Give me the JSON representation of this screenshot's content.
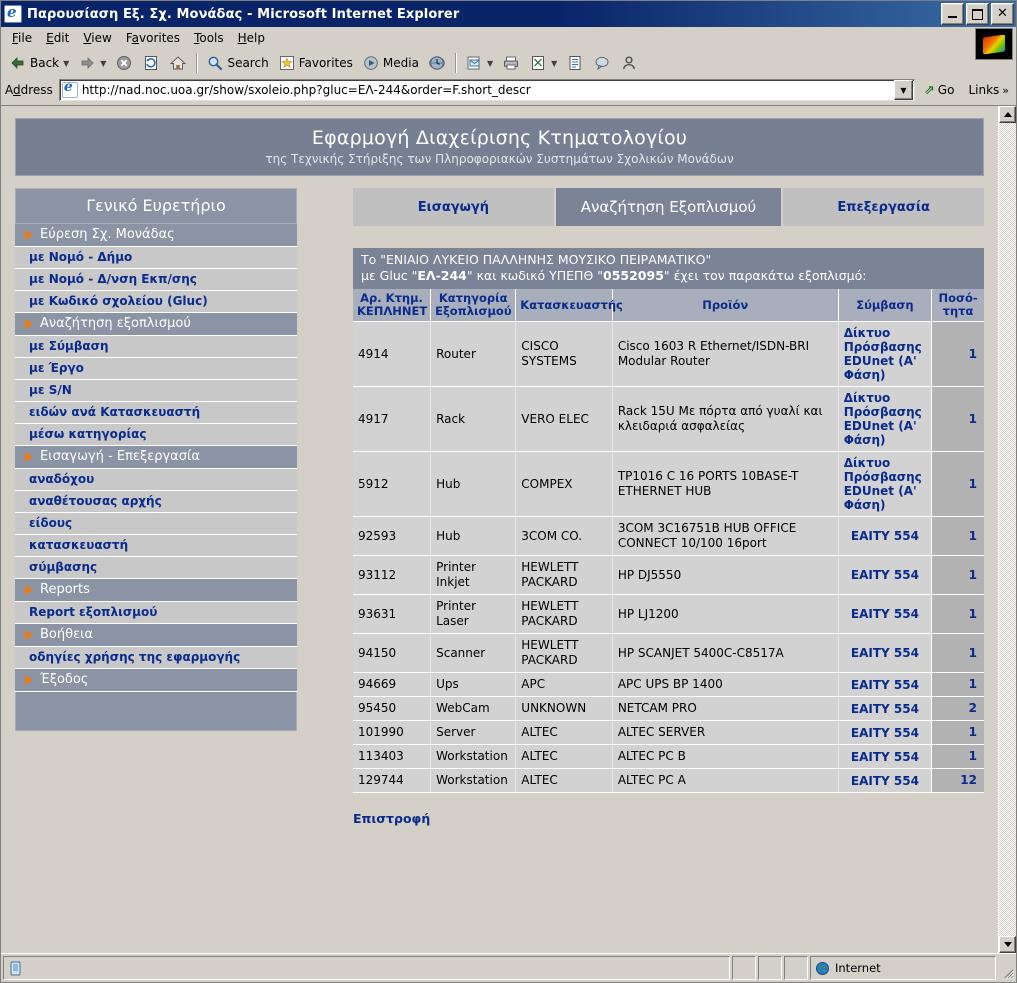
{
  "window": {
    "title": "Παρουσίαση Εξ. Σχ. Μονάδας - Microsoft Internet Explorer",
    "minimize_label": "_",
    "maximize_label": "□",
    "close_label": "✕"
  },
  "menu": {
    "items": [
      {
        "label": "File"
      },
      {
        "label": "Edit"
      },
      {
        "label": "View"
      },
      {
        "label": "Favorites"
      },
      {
        "label": "Tools"
      },
      {
        "label": "Help"
      }
    ]
  },
  "toolbar": {
    "back_label": "Back",
    "search_label": "Search",
    "favorites_label": "Favorites",
    "media_label": "Media"
  },
  "address": {
    "label": "Address",
    "url": "http://nad.noc.uoa.gr/show/sxoleio.php?gluc=ΕΛ-244&order=F.short_descr",
    "go_label": "Go",
    "links_label": "Links"
  },
  "app_header": {
    "title": "Εφαρμογή Διαχείρισης Κτηματολογίου",
    "subtitle": "της Τεχνικής Στήριξης των Πληροφοριακών Συστημάτων Σχολικών Μονάδων"
  },
  "sidebar": {
    "title": "Γενικό Ευρετήριο",
    "items": [
      {
        "label": "Εύρεση Σχ. Μονάδας",
        "type": "group"
      },
      {
        "label": "με Νομό - Δήμο",
        "type": "link"
      },
      {
        "label": "με Νομό - Δ/νση Εκπ/σης",
        "type": "link"
      },
      {
        "label": "με Κωδικό σχολείου (Gluc)",
        "type": "link"
      },
      {
        "label": "Αναζήτηση εξοπλισμού",
        "type": "group"
      },
      {
        "label": "με Σύμβαση",
        "type": "link"
      },
      {
        "label": "με Έργο",
        "type": "link"
      },
      {
        "label": "με S/N",
        "type": "link"
      },
      {
        "label": "ειδών ανά Κατασκευαστή",
        "type": "link"
      },
      {
        "label": "μέσω κατηγορίας",
        "type": "link"
      },
      {
        "label": "Εισαγωγή - Επεξεργασία",
        "type": "group"
      },
      {
        "label": "αναδόχου",
        "type": "link"
      },
      {
        "label": "αναθέτουσας αρχής",
        "type": "link"
      },
      {
        "label": "είδους",
        "type": "link"
      },
      {
        "label": "κατασκευαστή",
        "type": "link"
      },
      {
        "label": "σύμβασης",
        "type": "link"
      },
      {
        "label": "Reports",
        "type": "group"
      },
      {
        "label": "Report εξοπλισμού",
        "type": "link"
      },
      {
        "label": "Βοήθεια",
        "type": "group"
      },
      {
        "label": "οδηγίες χρήσης της εφαρμογής",
        "type": "link"
      },
      {
        "label": "Έξοδος",
        "type": "group"
      }
    ]
  },
  "tabs": [
    {
      "label": "Εισαγωγή",
      "active": false
    },
    {
      "label": "Αναζήτηση Εξοπλισμού",
      "active": true
    },
    {
      "label": "Επεξεργασία",
      "active": false
    }
  ],
  "info_banner": {
    "line1": "Το \"ΕΝΙΑΙΟ ΛΥΚΕΙΟ ΠΑΛΛΗΝΗΣ ΜΟΥΣΙΚΟ ΠΕΙΡΑΜΑΤΙΚΟ\"",
    "line2_prefix": "με Gluc \"",
    "gluc": "ΕΛ-244",
    "line2_mid": "\" και κωδικό ΥΠΕΠΘ \"",
    "ypepth": "0552095",
    "line2_suffix": "\" έχει τον παρακάτω εξοπλισμό:"
  },
  "table": {
    "headers": [
      "Αρ. Κτημ. ΚΕΠΛΗΝΕΤ",
      "Κατηγορία Εξοπλισμού",
      "Κατασκευαστής",
      "Προϊόν",
      "Σύμβαση",
      "Ποσό- τητα"
    ],
    "rows": [
      {
        "id": "4914",
        "category": "Router",
        "manufacturer": "CISCO SYSTEMS",
        "product": "Cisco 1603 R Ethernet/ISDN-BRI Modular Router",
        "contract": "Δίκτυο Πρόσβασης EDUnet (Α' Φάση)",
        "contract_multiline": true,
        "qty": "1"
      },
      {
        "id": "4917",
        "category": "Rack",
        "manufacturer": "VERO ELEC",
        "product": "Rack 15U Με πόρτα από γυαλί και κλειδαριά ασφαλείας",
        "contract": "Δίκτυο Πρόσβασης EDUnet (Α' Φάση)",
        "contract_multiline": true,
        "qty": "1"
      },
      {
        "id": "5912",
        "category": "Hub",
        "manufacturer": "COMPEX",
        "product": "TP1016 C 16 PORTS 10BASE-T ETHERNET HUB",
        "contract": "Δίκτυο Πρόσβασης EDUnet (Α' Φάση)",
        "contract_multiline": true,
        "qty": "1"
      },
      {
        "id": "92593",
        "category": "Hub",
        "manufacturer": "3COM CO.",
        "product": "3COM 3C16751B HUB OFFICE CONNECT 10/100 16port",
        "contract": "ΕΑΙΤΥ 554",
        "contract_multiline": false,
        "qty": "1"
      },
      {
        "id": "93112",
        "category": "Printer Inkjet",
        "manufacturer": "HEWLETT PACKARD",
        "product": "HP DJ5550",
        "contract": "ΕΑΙΤΥ 554",
        "contract_multiline": false,
        "qty": "1"
      },
      {
        "id": "93631",
        "category": "Printer Laser",
        "manufacturer": "HEWLETT PACKARD",
        "product": "HP LJ1200",
        "contract": "ΕΑΙΤΥ 554",
        "contract_multiline": false,
        "qty": "1"
      },
      {
        "id": "94150",
        "category": "Scanner",
        "manufacturer": "HEWLETT PACKARD",
        "product": "HP SCANJET 5400C-C8517A",
        "contract": "ΕΑΙΤΥ 554",
        "contract_multiline": false,
        "qty": "1"
      },
      {
        "id": "94669",
        "category": "Ups",
        "manufacturer": "APC",
        "product": "APC UPS BP 1400",
        "contract": "ΕΑΙΤΥ 554",
        "contract_multiline": false,
        "qty": "1"
      },
      {
        "id": "95450",
        "category": "WebCam",
        "manufacturer": "UNKNOWN",
        "product": "NETCAM PRO",
        "contract": "ΕΑΙΤΥ 554",
        "contract_multiline": false,
        "qty": "2"
      },
      {
        "id": "101990",
        "category": "Server",
        "manufacturer": "ALTEC",
        "product": "ALTEC SERVER",
        "contract": "ΕΑΙΤΥ 554",
        "contract_multiline": false,
        "qty": "1"
      },
      {
        "id": "113403",
        "category": "Workstation",
        "manufacturer": "ALTEC",
        "product": "ALTEC PC B",
        "contract": "ΕΑΙΤΥ 554",
        "contract_multiline": false,
        "qty": "1"
      },
      {
        "id": "129744",
        "category": "Workstation",
        "manufacturer": "ALTEC",
        "product": "ALTEC PC A",
        "contract": "ΕΑΙΤΥ 554",
        "contract_multiline": false,
        "qty": "12"
      }
    ]
  },
  "back_link": "Επιστροφή",
  "statusbar": {
    "message": "",
    "zone": "Internet"
  },
  "colors": {
    "title_bar": "#0a246a",
    "app_header_bg": "#778093",
    "sidebar_group_bg": "#8a94a5",
    "sidebar_link_bg": "#c8c8c8",
    "link_text": "#0a2b8c",
    "marker_orange": "#f07a12",
    "table_header_bg": "#a8aebb",
    "table_cell_bg": "#d2d2d2",
    "qty_cell_bg": "#b2b2b2",
    "page_bg": "#d4d0c8"
  }
}
